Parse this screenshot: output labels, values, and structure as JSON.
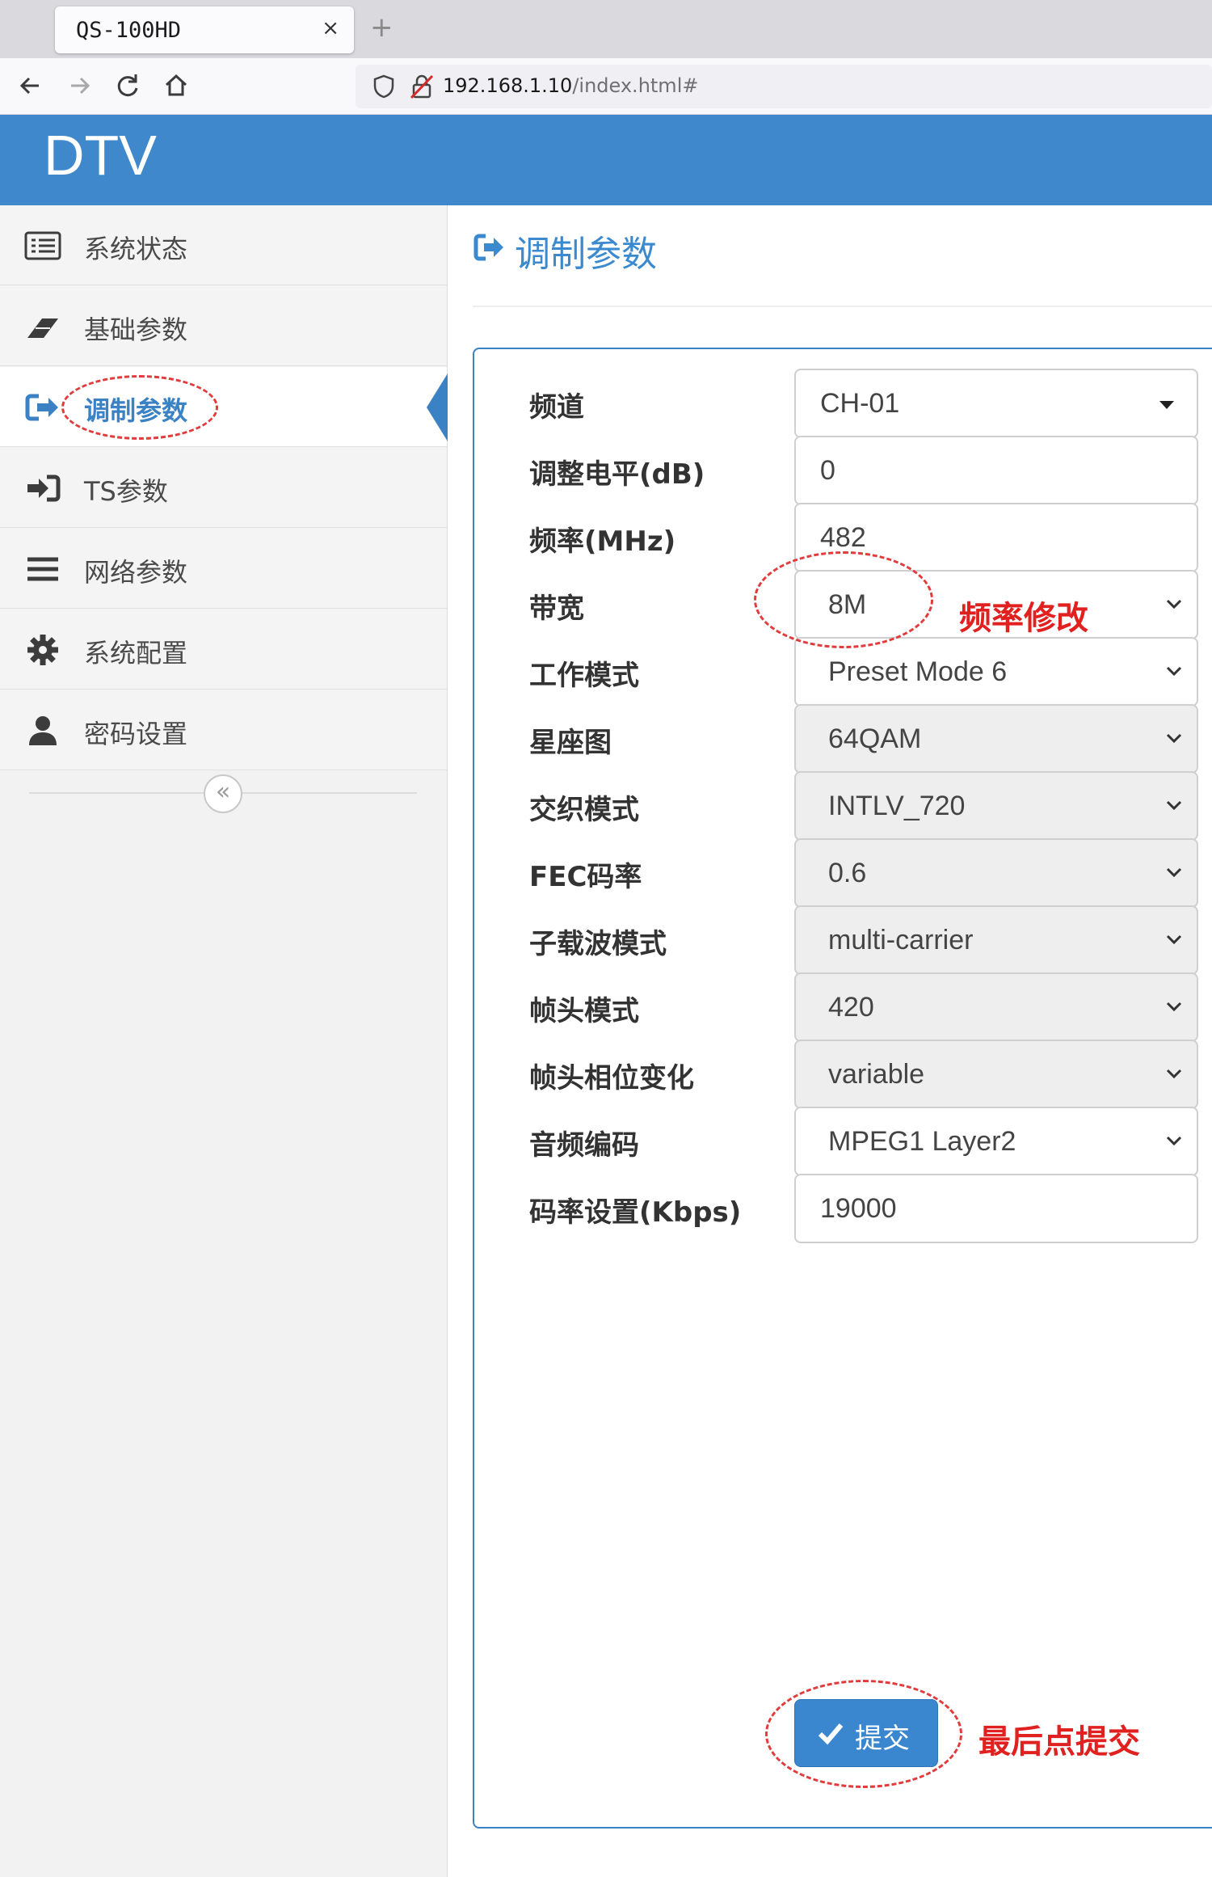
{
  "browser": {
    "tab_title": "QS-100HD",
    "tab_close": "×",
    "new_tab": "+",
    "url_host": "192.168.1.10",
    "url_path": "/index.html#"
  },
  "app": {
    "title": "DTV",
    "accent_color": "#3f88cb"
  },
  "sidebar": {
    "items": [
      {
        "label": "系统状态",
        "icon": "list-icon"
      },
      {
        "label": "基础参数",
        "icon": "eraser-icon"
      },
      {
        "label": "调制参数",
        "icon": "sign-out-icon",
        "active": true
      },
      {
        "label": "TS参数",
        "icon": "sign-in-icon"
      },
      {
        "label": "网络参数",
        "icon": "bars-icon"
      },
      {
        "label": "系统配置",
        "icon": "gear-icon"
      },
      {
        "label": "密码设置",
        "icon": "user-icon"
      }
    ],
    "collapse_glyph": "«"
  },
  "page": {
    "title": "调制参数"
  },
  "form": {
    "fields": [
      {
        "label": "频道",
        "value": "CH-01",
        "type": "select-caret"
      },
      {
        "label": "调整电平(dB)",
        "value": "0",
        "type": "input"
      },
      {
        "label": "频率(MHz)",
        "value": "482",
        "type": "input"
      },
      {
        "label": "带宽",
        "value": "8M",
        "type": "select"
      },
      {
        "label": "工作模式",
        "value": "Preset Mode 6",
        "type": "select"
      },
      {
        "label": "星座图",
        "value": "64QAM",
        "type": "select",
        "disabled": true
      },
      {
        "label": "交织模式",
        "value": "INTLV_720",
        "type": "select",
        "disabled": true
      },
      {
        "label": "FEC码率",
        "value": "0.6",
        "type": "select",
        "disabled": true
      },
      {
        "label": "子载波模式",
        "value": "multi-carrier",
        "type": "select",
        "disabled": true
      },
      {
        "label": "帧头模式",
        "value": "420",
        "type": "select",
        "disabled": true
      },
      {
        "label": "帧头相位变化",
        "value": "variable",
        "type": "select",
        "disabled": true
      },
      {
        "label": "音频编码",
        "value": "MPEG1 Layer2",
        "type": "select"
      },
      {
        "label": "码率设置(Kbps)",
        "value": "19000",
        "type": "input"
      }
    ],
    "submit_label": "提交"
  },
  "annotations": {
    "freq_note": "频率修改",
    "submit_note": "最后点提交",
    "color": "#e0211f"
  }
}
